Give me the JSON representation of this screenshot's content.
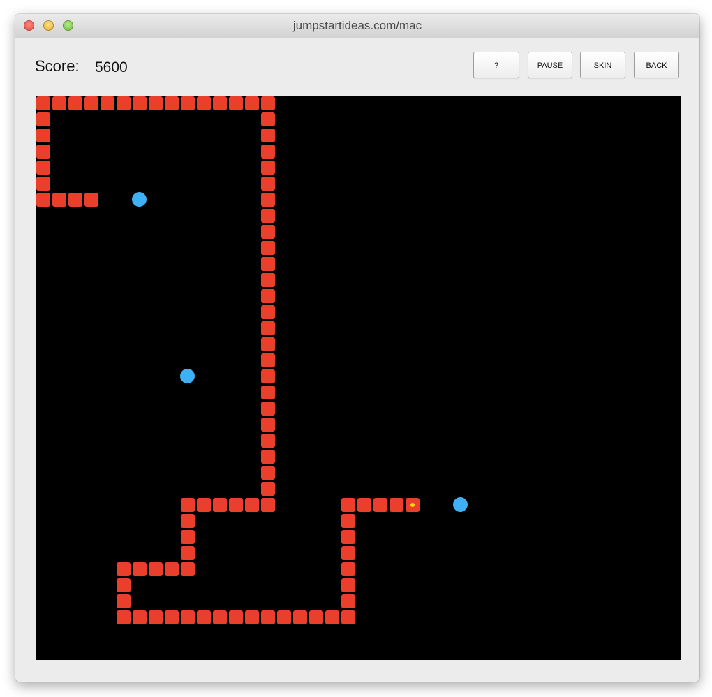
{
  "window": {
    "title": "jumpstartideas.com/mac"
  },
  "header": {
    "score_label": "Score:",
    "score_value": "5600"
  },
  "toolbar": {
    "help_label": "?",
    "pause_label": "PAUSE",
    "skin_label": "SKIN",
    "back_label": "BACK"
  },
  "game": {
    "grid": {
      "cols": 40,
      "rows": 35
    },
    "snake_color": "#ea3f2a",
    "head_marker_color": "#ffd31a",
    "food_color": "#3fb0f5",
    "board_color": "#000000",
    "snake": [
      [
        0,
        6
      ],
      [
        1,
        6
      ],
      [
        2,
        6
      ],
      [
        3,
        6
      ],
      [
        0,
        5
      ],
      [
        0,
        4
      ],
      [
        0,
        3
      ],
      [
        0,
        2
      ],
      [
        0,
        1
      ],
      [
        0,
        0
      ],
      [
        1,
        0
      ],
      [
        2,
        0
      ],
      [
        3,
        0
      ],
      [
        4,
        0
      ],
      [
        5,
        0
      ],
      [
        6,
        0
      ],
      [
        7,
        0
      ],
      [
        8,
        0
      ],
      [
        9,
        0
      ],
      [
        10,
        0
      ],
      [
        11,
        0
      ],
      [
        12,
        0
      ],
      [
        13,
        0
      ],
      [
        14,
        0
      ],
      [
        14,
        1
      ],
      [
        14,
        2
      ],
      [
        14,
        3
      ],
      [
        14,
        4
      ],
      [
        14,
        5
      ],
      [
        14,
        6
      ],
      [
        14,
        7
      ],
      [
        14,
        8
      ],
      [
        14,
        9
      ],
      [
        14,
        10
      ],
      [
        14,
        11
      ],
      [
        14,
        12
      ],
      [
        14,
        13
      ],
      [
        14,
        14
      ],
      [
        14,
        15
      ],
      [
        14,
        16
      ],
      [
        14,
        17
      ],
      [
        14,
        18
      ],
      [
        14,
        19
      ],
      [
        14,
        20
      ],
      [
        14,
        21
      ],
      [
        14,
        22
      ],
      [
        14,
        23
      ],
      [
        14,
        24
      ],
      [
        14,
        25
      ],
      [
        13,
        25
      ],
      [
        12,
        25
      ],
      [
        11,
        25
      ],
      [
        10,
        25
      ],
      [
        9,
        25
      ],
      [
        9,
        26
      ],
      [
        9,
        27
      ],
      [
        9,
        28
      ],
      [
        9,
        29
      ],
      [
        8,
        29
      ],
      [
        7,
        29
      ],
      [
        6,
        29
      ],
      [
        5,
        29
      ],
      [
        5,
        30
      ],
      [
        5,
        31
      ],
      [
        5,
        32
      ],
      [
        6,
        32
      ],
      [
        7,
        32
      ],
      [
        8,
        32
      ],
      [
        9,
        32
      ],
      [
        10,
        32
      ],
      [
        11,
        32
      ],
      [
        12,
        32
      ],
      [
        13,
        32
      ],
      [
        14,
        32
      ],
      [
        15,
        32
      ],
      [
        16,
        32
      ],
      [
        17,
        32
      ],
      [
        18,
        32
      ],
      [
        19,
        32
      ],
      [
        19,
        31
      ],
      [
        19,
        30
      ],
      [
        19,
        29
      ],
      [
        19,
        28
      ],
      [
        19,
        27
      ],
      [
        19,
        26
      ],
      [
        19,
        25
      ],
      [
        20,
        25
      ],
      [
        21,
        25
      ],
      [
        22,
        25
      ],
      [
        23,
        25
      ]
    ],
    "head": [
      23,
      25
    ],
    "food": [
      [
        6,
        6
      ],
      [
        9,
        17
      ],
      [
        26,
        25
      ]
    ]
  }
}
